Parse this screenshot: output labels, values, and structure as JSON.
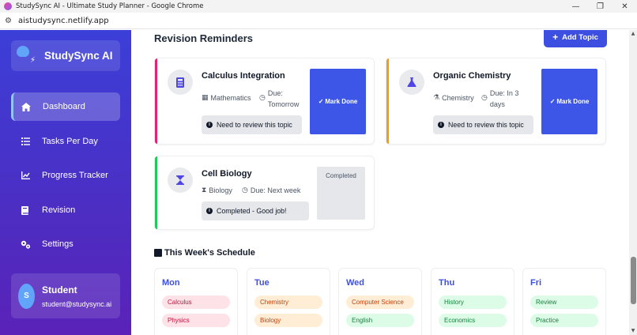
{
  "browser": {
    "title": "StudySync AI - Ultimate Study Planner - Google Chrome",
    "url": "aistudysync.netlify.app",
    "minimize": "—",
    "maximize": "❐",
    "close": "✕"
  },
  "sidebar": {
    "logo": "StudySync AI",
    "items": [
      {
        "label": "Dashboard",
        "icon": "home-icon"
      },
      {
        "label": "Tasks Per Day",
        "icon": "list-icon"
      },
      {
        "label": "Progress Tracker",
        "icon": "chart-line-icon"
      },
      {
        "label": "Revision",
        "icon": "book-icon"
      },
      {
        "label": "Settings",
        "icon": "gears-icon"
      }
    ],
    "user": {
      "initial": "S",
      "name": "Student",
      "email": "student@studysync.ai"
    }
  },
  "revision": {
    "title": "Revision Reminders",
    "add_label": "Add Topic",
    "cards": [
      {
        "title": "Calculus Integration",
        "subject": "Mathematics",
        "due_line1": "Due:",
        "due_line2": "Tomorrow",
        "note": "Need to review this topic",
        "action": "Mark Done",
        "accent": "#db2777"
      },
      {
        "title": "Organic Chemistry",
        "subject": "Chemistry",
        "due_line1": "Due: In 3",
        "due_line2": "days",
        "note": "Need to review this topic",
        "action": "Mark Done",
        "accent": "#f59e0b"
      },
      {
        "title": "Cell Biology",
        "subject": "Biology",
        "due": "Due: Next week",
        "note": "Completed - Good job!",
        "status": "Completed",
        "accent": "#22c55e"
      }
    ]
  },
  "schedule": {
    "title": "This Week's Schedule",
    "days": [
      {
        "name": "Mon",
        "subjects": [
          "Calculus",
          "Physics"
        ]
      },
      {
        "name": "Tue",
        "subjects": [
          "Chemistry",
          "Biology"
        ]
      },
      {
        "name": "Wed",
        "subjects": [
          "Computer Science",
          "English"
        ]
      },
      {
        "name": "Thu",
        "subjects": [
          "History",
          "Economics"
        ]
      },
      {
        "name": "Fri",
        "subjects": [
          "Review",
          "Practice"
        ]
      }
    ]
  },
  "colors": {
    "primary": "#3d4fe0",
    "pink": "#fde2e7",
    "orange": "#ffedd5",
    "green": "#dcfce7"
  }
}
